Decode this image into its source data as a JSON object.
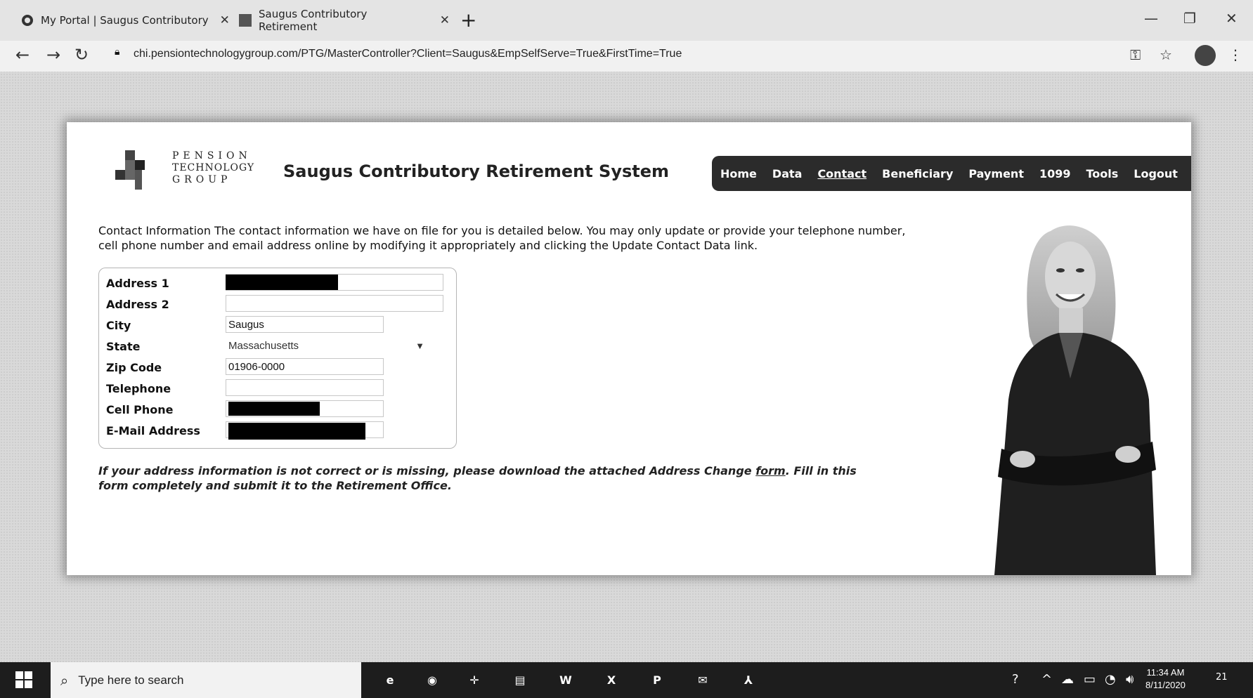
{
  "browser": {
    "tabs": [
      {
        "label": "My Portal | Saugus Contributory"
      },
      {
        "label": "Saugus Contributory Retirement"
      }
    ],
    "url": "chi.pensiontechnologygroup.com/PTG/MasterController?Client=Saugus&EmpSelfServe=True&FirstTime=True"
  },
  "header": {
    "logo_lines": [
      "PENSION",
      "TECHNOLOGY",
      "GROUP"
    ],
    "site_title": "Saugus Contributory Retirement System"
  },
  "nav": {
    "items": [
      "Home",
      "Data",
      "Contact",
      "Beneficiary",
      "Payment",
      "1099",
      "Tools",
      "Logout"
    ],
    "active": "Contact"
  },
  "intro": "Contact Information  The contact information we have on file for you is detailed below. You may only update or provide your telephone number, cell phone number and email address online by modifying it appropriately and clicking the Update Contact Data link.",
  "form": {
    "address1": {
      "label": "Address 1",
      "value": ""
    },
    "address2": {
      "label": "Address 2",
      "value": ""
    },
    "city": {
      "label": "City",
      "value": "Saugus"
    },
    "state": {
      "label": "State",
      "value": "Massachusetts"
    },
    "zip": {
      "label": "Zip Code",
      "value": "01906-0000"
    },
    "telephone": {
      "label": "Telephone",
      "value": ""
    },
    "cell": {
      "label": "Cell Phone",
      "value": ""
    },
    "email": {
      "label": "E-Mail Address",
      "value": ""
    }
  },
  "note": {
    "before": "If your address information is not correct or is missing, please download the attached Address Change ",
    "link": "form",
    "after": ". Fill in this form completely and submit it to the Retirement Office."
  },
  "taskbar": {
    "search_placeholder": "Type here to search",
    "time": "11:34 AM",
    "date": "8/11/2020",
    "notifications": "21"
  },
  "colors": {
    "nav_bg": "#2b2b2b",
    "card_bg": "#ffffff"
  }
}
